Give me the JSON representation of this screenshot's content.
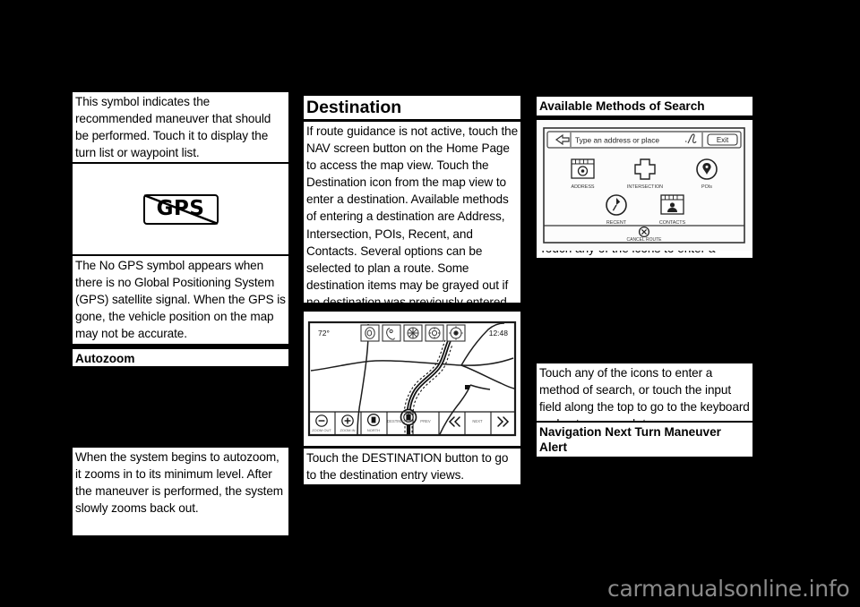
{
  "page": {
    "background_color": "#000000",
    "text_color": "#000000",
    "block_color": "#ffffff",
    "watermark": "carmanualsonline.info",
    "watermark_color": "#8a8a8a"
  },
  "column_left": {
    "para_maneuver": "This symbol indicates the recommended maneuver that should be performed. Touch it to display the turn list or waypoint list.",
    "gps_symbol": {
      "label": "GPS",
      "name": "no-gps-symbol"
    },
    "para_nogps": "The No GPS symbol appears when there is no Global Positioning System (GPS) satellite signal. When the GPS is gone, the vehicle position on the map may not be accurate.",
    "heading_autozoom": "Autozoom",
    "para_autozoom": "When the system begins to autozoom, it zooms in to its minimum level. After the maneuver is performed, the system slowly zooms back out."
  },
  "column_middle": {
    "heading_destination": "Destination",
    "para_destination": "If route guidance is not active, touch the NAV screen button on the Home Page to access the map view. Touch the Destination icon from the map view to enter a destination. Available methods of entering a destination are Address, Intersection, POIs, Recent, and Contacts. Several options can be selected to plan a route. Some destination items may be grayed out if no destination was previously entered or saved.",
    "nav_map_screenshot": {
      "temperature": "72°",
      "clock": "12:48",
      "top_icons": [
        "audio-icon",
        "phone-icon",
        "nav-icon",
        "settings-icon",
        "current-location-icon"
      ],
      "bottom_buttons": [
        "ZOOM OUT",
        "ZOOM IN",
        "NORTH",
        "DESTINATION",
        "PREV",
        "BACK",
        "NEXT",
        "FORWARD"
      ]
    },
    "caption_destination": "Touch the DESTINATION button to go to the destination entry views."
  },
  "column_right": {
    "heading_methods": "Available Methods of Search",
    "search_screenshot": {
      "input_placeholder": "Type an address or place",
      "back_icon": "back-arrow-icon",
      "keyboard_icon": "handwriting-icon",
      "exit_label": "Exit",
      "methods": [
        {
          "label": "ADDRESS",
          "icon": "address-icon"
        },
        {
          "label": "INTERSECTION",
          "icon": "intersection-icon"
        },
        {
          "label": "POIs",
          "icon": "poi-pin-icon"
        },
        {
          "label": "RECENT",
          "icon": "recent-clock-icon"
        },
        {
          "label": "CONTACTS",
          "icon": "contacts-icon"
        }
      ],
      "cancel_route": {
        "label": "CANCEL ROUTE",
        "icon": "cancel-route-icon"
      }
    },
    "clipped_line": "Touch any of the icons to enter a",
    "para_touch_icons": "Touch any of the icons to enter a method of search, or touch the input field along the top to go to the keyboard and enter a search term.",
    "heading_next_turn": "Navigation Next Turn Maneuver Alert"
  }
}
